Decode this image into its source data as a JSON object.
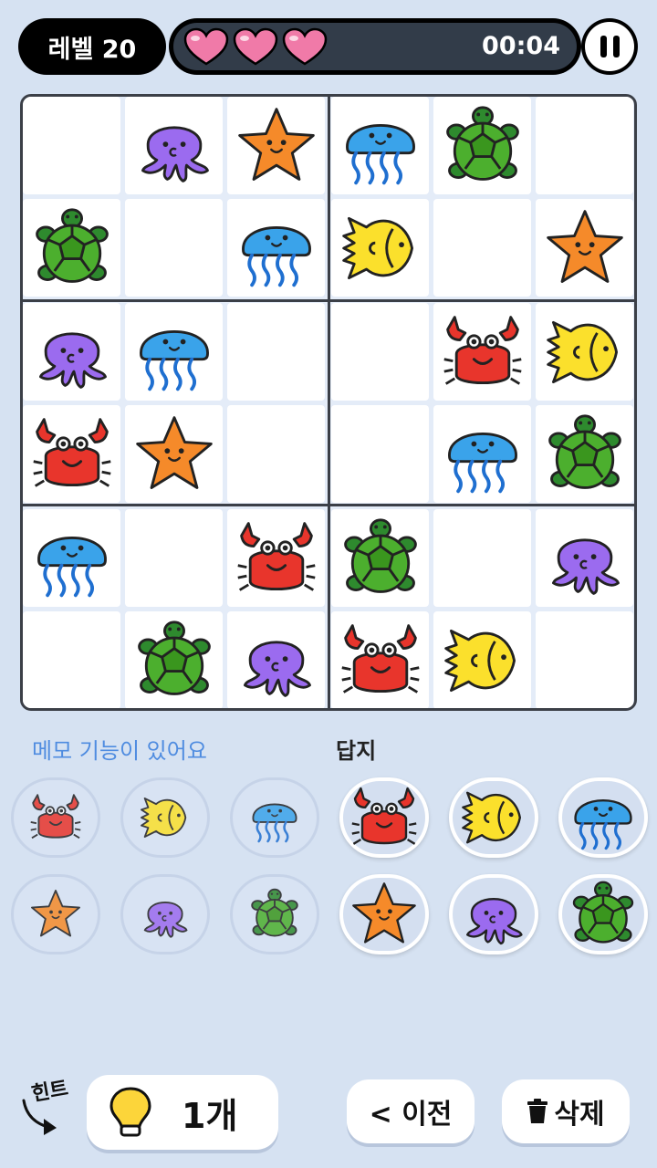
{
  "header": {
    "level_label": "레벨 20",
    "lives": 3,
    "timer": "00:04"
  },
  "colors": {
    "background": "#d6e2f2",
    "heart": "#f07aa8",
    "memo_label": "#4f8ce0"
  },
  "board": {
    "grid": [
      [
        "",
        "octopus",
        "starfish",
        "jellyfish",
        "turtle",
        ""
      ],
      [
        "turtle",
        "",
        "jellyfish",
        "fish",
        "",
        "starfish"
      ],
      [
        "octopus",
        "jellyfish",
        "",
        "",
        "crab",
        "fish"
      ],
      [
        "crab",
        "starfish",
        "",
        "",
        "jellyfish",
        "turtle"
      ],
      [
        "jellyfish",
        "",
        "crab",
        "turtle",
        "",
        "octopus"
      ],
      [
        "",
        "turtle",
        "octopus",
        "crab",
        "fish",
        ""
      ]
    ]
  },
  "panels": {
    "memo_label": "메모 기능이 있어요",
    "answer_label": "답지",
    "memo_items": [
      "crab",
      "fish",
      "jellyfish",
      "starfish",
      "octopus",
      "turtle"
    ],
    "answer_items": [
      "crab",
      "fish",
      "jellyfish",
      "starfish",
      "octopus",
      "turtle"
    ]
  },
  "footer": {
    "hint_tag": "힌트",
    "hint_count": "1개",
    "prev_label": "< 이전",
    "delete_label": "삭제"
  },
  "icons": {
    "crab": "crab-icon",
    "fish": "fish-icon",
    "jellyfish": "jellyfish-icon",
    "starfish": "starfish-icon",
    "octopus": "octopus-icon",
    "turtle": "turtle-icon"
  }
}
